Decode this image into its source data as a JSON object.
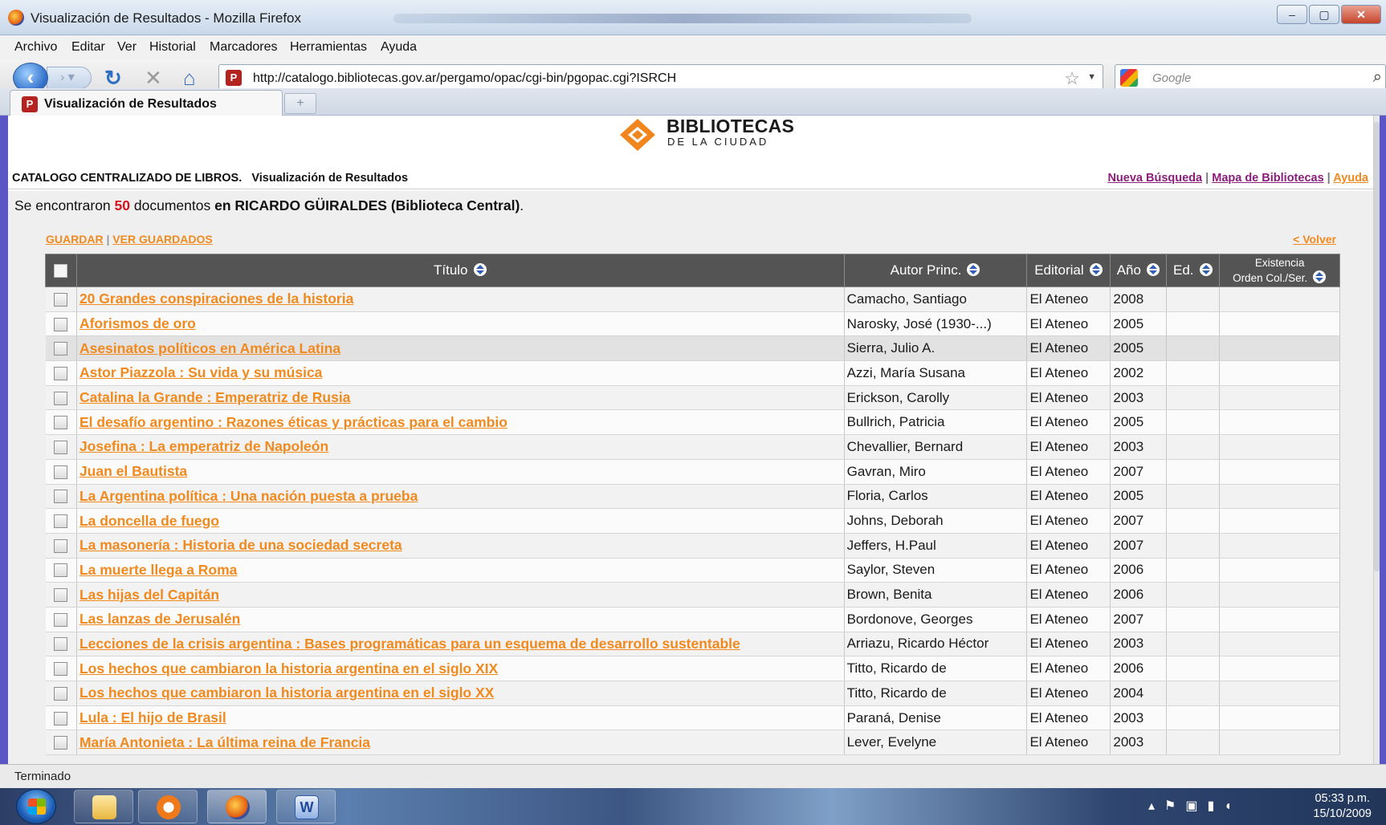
{
  "window": {
    "title": "Visualización de Resultados - Mozilla Firefox"
  },
  "menu": [
    "Archivo",
    "Editar",
    "Ver",
    "Historial",
    "Marcadores",
    "Herramientas",
    "Ayuda"
  ],
  "nav": {
    "url": "http://catalogo.bibliotecas.gov.ar/pergamo/opac/cgi-bin/pgopac.cgi?ISRCH",
    "search_placeholder": "Google"
  },
  "tab": {
    "label": "Visualización de Resultados"
  },
  "logo": {
    "line1": "BIBLIOTECAS",
    "line2": "DE LA CIUDAD"
  },
  "header": {
    "catalog": "CATALOGO CENTRALIZADO DE LIBROS.",
    "view": "Visualización de Resultados",
    "links": {
      "nueva": "Nueva Búsqueda",
      "mapa": "Mapa de Bibliotecas",
      "ayuda": "Ayuda"
    }
  },
  "summary": {
    "prefix": "Se encontraron",
    "count": "50",
    "middle": "documentos",
    "place": "en RICARDO GÜIRALDES (Biblioteca Central)",
    "suffix": "."
  },
  "actions": {
    "guardar": "GUARDAR",
    "ver_guardados": "VER GUARDADOS",
    "volver": "< Volver"
  },
  "table": {
    "headers": {
      "titulo": "Título",
      "autor": "Autor Princ.",
      "editorial": "Editorial",
      "anio": "Año",
      "ed": "Ed.",
      "existencia_line1": "Existencia",
      "existencia_line2": "Orden Col./Ser."
    },
    "rows": [
      {
        "titulo": "20 Grandes conspiraciones de la historia",
        "autor": "Camacho, Santiago",
        "editorial": "El Ateneo",
        "anio": "2008"
      },
      {
        "titulo": "Aforismos de oro",
        "autor": "Narosky, José (1930-...)",
        "editorial": "El Ateneo",
        "anio": "2005"
      },
      {
        "titulo": "Asesinatos políticos en América Latina",
        "autor": "Sierra, Julio A.",
        "editorial": "El Ateneo",
        "anio": "2005"
      },
      {
        "titulo": "Astor Piazzola : Su vida y su música",
        "autor": "Azzi, María Susana",
        "editorial": "El Ateneo",
        "anio": "2002"
      },
      {
        "titulo": "Catalina la Grande : Emperatriz de Rusia",
        "autor": "Erickson, Carolly",
        "editorial": "El Ateneo",
        "anio": "2003"
      },
      {
        "titulo": "El desafío argentino : Razones éticas y prácticas para el cambio",
        "autor": "Bullrich, Patricia",
        "editorial": "El Ateneo",
        "anio": "2005"
      },
      {
        "titulo": "Josefina : La emperatriz de Napoleón",
        "autor": "Chevallier, Bernard",
        "editorial": "El Ateneo",
        "anio": "2003"
      },
      {
        "titulo": "Juan el Bautista",
        "autor": "Gavran, Miro",
        "editorial": "El Ateneo",
        "anio": "2007"
      },
      {
        "titulo": "La Argentina política : Una nación puesta a prueba",
        "autor": "Floria, Carlos",
        "editorial": "El Ateneo",
        "anio": "2005"
      },
      {
        "titulo": "La doncella de fuego",
        "autor": "Johns, Deborah",
        "editorial": "El Ateneo",
        "anio": "2007"
      },
      {
        "titulo": "La masonería : Historia de una sociedad secreta",
        "autor": "Jeffers, H.Paul",
        "editorial": "El Ateneo",
        "anio": "2007"
      },
      {
        "titulo": "La muerte llega a Roma",
        "autor": "Saylor, Steven",
        "editorial": "El Ateneo",
        "anio": "2006"
      },
      {
        "titulo": "Las hijas del Capitán",
        "autor": "Brown, Benita",
        "editorial": "El Ateneo",
        "anio": "2006"
      },
      {
        "titulo": "Las lanzas de Jerusalén",
        "autor": "Bordonove, Georges",
        "editorial": "El Ateneo",
        "anio": "2007"
      },
      {
        "titulo": "Lecciones de la crisis argentina : Bases programáticas para un esquema de desarrollo sustentable",
        "autor": "Arriazu, Ricardo Héctor",
        "editorial": "El Ateneo",
        "anio": "2003"
      },
      {
        "titulo": "Los hechos que cambiaron la historia argentina en el siglo XIX",
        "autor": "Titto, Ricardo de",
        "editorial": "El Ateneo",
        "anio": "2006"
      },
      {
        "titulo": "Los hechos que cambiaron la historia argentina en el siglo XX",
        "autor": "Titto, Ricardo de",
        "editorial": "El Ateneo",
        "anio": "2004"
      },
      {
        "titulo": "Lula : El hijo de Brasil",
        "autor": "Paraná, Denise",
        "editorial": "El Ateneo",
        "anio": "2003"
      },
      {
        "titulo": "María Antonieta : La última reina de Francia",
        "autor": "Lever, Evelyne",
        "editorial": "El Ateneo",
        "anio": "2003"
      }
    ]
  },
  "status": "Terminado",
  "clock": {
    "time": "05:33 p.m.",
    "date": "15/10/2009"
  },
  "colors": {
    "link_orange": "#f08a1e",
    "link_purple": "#8a1e7a",
    "count_red": "#d4141e",
    "table_header": "#545454"
  }
}
